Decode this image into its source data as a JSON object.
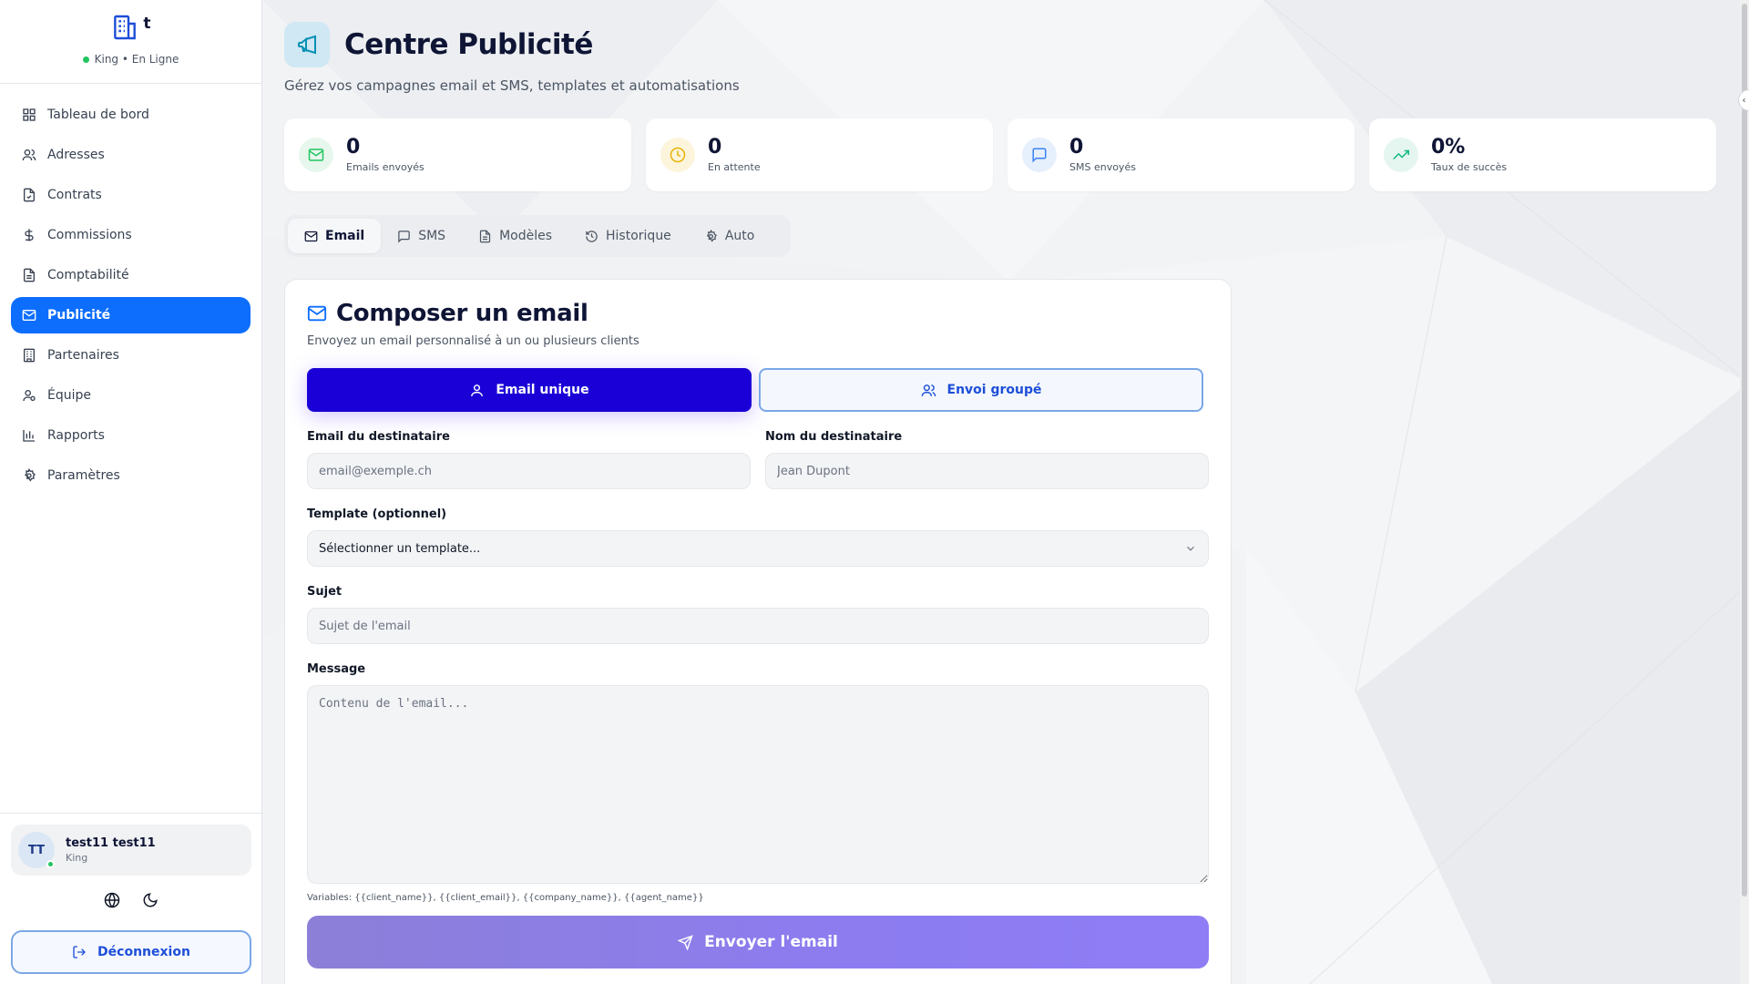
{
  "brand": {
    "mark": "t",
    "status_text": "King • En Ligne"
  },
  "sidebar": {
    "items": [
      {
        "label": "Tableau de bord",
        "icon": "dashboard-icon"
      },
      {
        "label": "Adresses",
        "icon": "users-icon"
      },
      {
        "label": "Contrats",
        "icon": "file-icon"
      },
      {
        "label": "Commissions",
        "icon": "dollar-icon"
      },
      {
        "label": "Comptabilité",
        "icon": "file-text-icon"
      },
      {
        "label": "Publicité",
        "icon": "mail-icon",
        "active": true
      },
      {
        "label": "Partenaires",
        "icon": "building-icon"
      },
      {
        "label": "Équipe",
        "icon": "team-icon"
      },
      {
        "label": "Rapports",
        "icon": "bar-chart-icon"
      },
      {
        "label": "Paramètres",
        "icon": "gear-icon"
      }
    ]
  },
  "user": {
    "initials": "TT",
    "name": "test11 test11",
    "role": "King"
  },
  "logout_label": "Déconnexion",
  "header": {
    "title": "Centre Publicité",
    "subtitle": "Gérez vos campagnes email et SMS, templates et automatisations"
  },
  "stats": [
    {
      "value": "0",
      "label": "Emails envoyés",
      "icon": "mail-icon",
      "color": "#22c55e",
      "bg": "#e7f7ee"
    },
    {
      "value": "0",
      "label": "En attente",
      "icon": "clock-icon",
      "color": "#eab308",
      "bg": "#fcf5dc"
    },
    {
      "value": "0",
      "label": "SMS envoyés",
      "icon": "message-icon",
      "color": "#3b82f6",
      "bg": "#e6effc"
    },
    {
      "value": "0%",
      "label": "Taux de succès",
      "icon": "trending-up-icon",
      "color": "#10b981",
      "bg": "#e4f6ef"
    }
  ],
  "tabs": [
    {
      "label": "Email",
      "icon": "mail-icon",
      "active": true
    },
    {
      "label": "SMS",
      "icon": "message-icon"
    },
    {
      "label": "Modèles",
      "icon": "file-text-icon"
    },
    {
      "label": "Historique",
      "icon": "history-icon"
    },
    {
      "label": "Auto",
      "icon": "gear-icon"
    }
  ],
  "compose": {
    "title": "Composer un email",
    "description": "Envoyez un email personnalisé à un ou plusieurs clients",
    "mode_single": "Email unique",
    "mode_group": "Envoi groupé",
    "recipient_email_label": "Email du destinataire",
    "recipient_email_placeholder": "email@exemple.ch",
    "recipient_name_label": "Nom du destinataire",
    "recipient_name_placeholder": "Jean Dupont",
    "template_label": "Template (optionnel)",
    "template_selected": "Sélectionner un template...",
    "subject_label": "Sujet",
    "subject_placeholder": "Sujet de l'email",
    "message_label": "Message",
    "message_placeholder": "Contenu de l'email...",
    "variables_text": "Variables: {{client_name}}, {{client_email}}, {{company_name}}, {{agent_name}}",
    "send_label": "Envoyer l'email"
  },
  "colors": {
    "accent": "#0d6efd",
    "primary_button": "#1a00d6",
    "send_button": "#8c7cf0"
  }
}
